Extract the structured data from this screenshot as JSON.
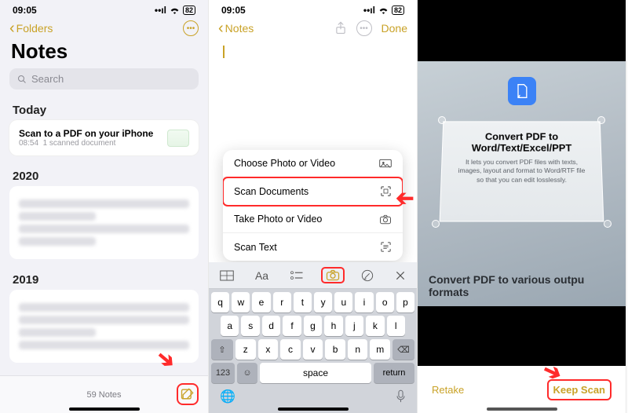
{
  "screen1": {
    "time": "09:05",
    "battery": "82",
    "back_label": "Folders",
    "title": "Notes",
    "search_placeholder": "Search",
    "sections": {
      "today": "Today",
      "y2020": "2020",
      "y2019": "2019"
    },
    "note": {
      "title": "Scan to a PDF on your iPhone",
      "time": "08:54",
      "subtitle": "1 scanned document"
    },
    "footer_count": "59 Notes"
  },
  "screen2": {
    "time": "09:05",
    "battery": "82",
    "back_label": "Notes",
    "done_label": "Done",
    "popup": {
      "choose": "Choose Photo or Video",
      "scan_docs": "Scan Documents",
      "take": "Take Photo or Video",
      "scan_text": "Scan Text"
    },
    "toolbar": {
      "aa": "Aa"
    },
    "keyboard": {
      "r1": [
        "q",
        "w",
        "e",
        "r",
        "t",
        "y",
        "u",
        "i",
        "o",
        "p"
      ],
      "r2": [
        "a",
        "s",
        "d",
        "f",
        "g",
        "h",
        "j",
        "k",
        "l"
      ],
      "r3": [
        "z",
        "x",
        "c",
        "v",
        "b",
        "n",
        "m"
      ],
      "num": "123",
      "space": "space",
      "return": "return"
    }
  },
  "screen3": {
    "doc_heading": "Convert PDF to Word/Text/Excel/PPT",
    "doc_body": "It lets you convert PDF files with texts, images, layout and format to Word/RTF file so that you can edit losslessly.",
    "sub1": "Convert PDF to various outpu",
    "sub2": "formats",
    "retake": "Retake",
    "keep": "Keep Scan"
  }
}
